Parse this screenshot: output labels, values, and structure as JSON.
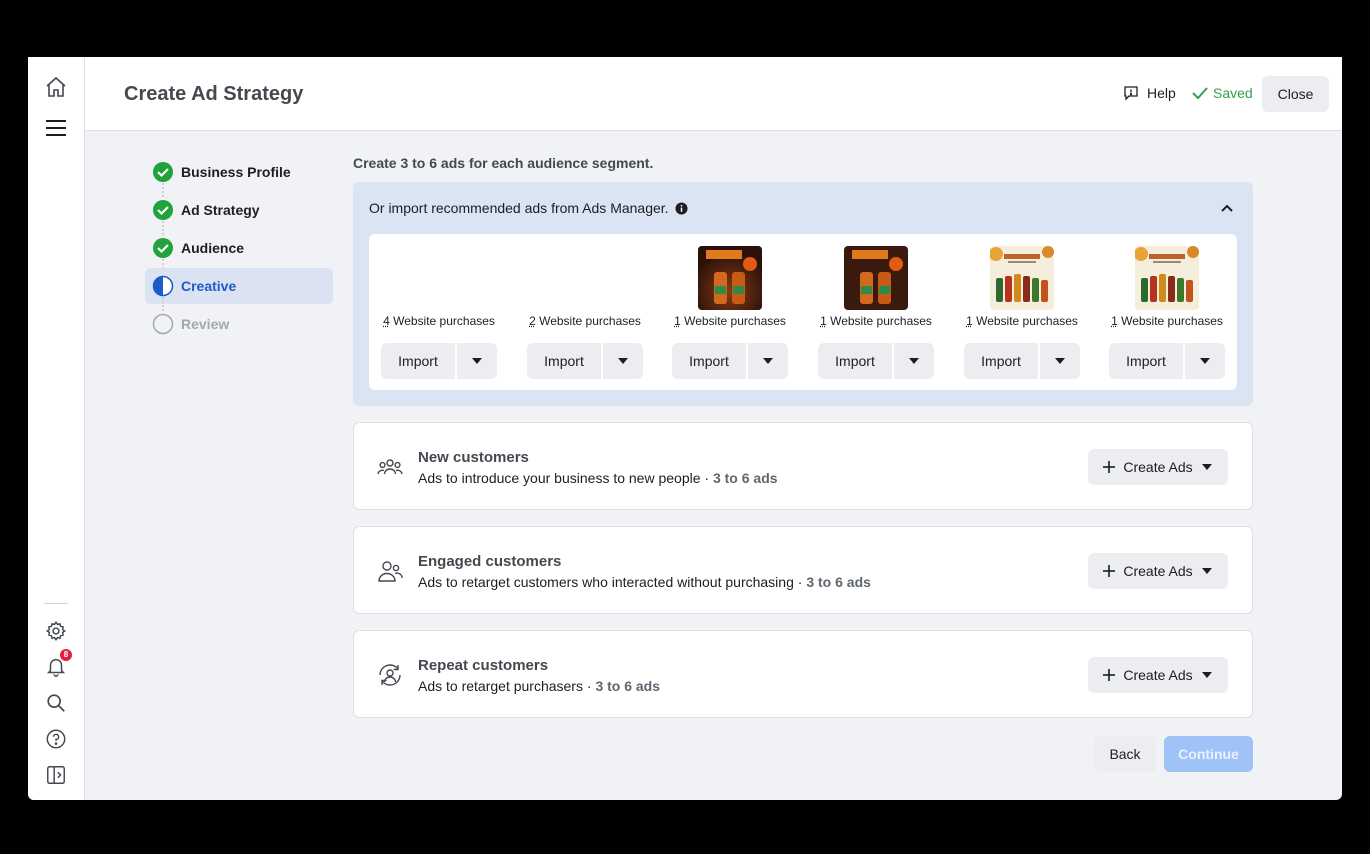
{
  "rail": {
    "notification_count": "8"
  },
  "header": {
    "title": "Create Ad Strategy",
    "help_label": "Help",
    "saved_label": "Saved",
    "close_label": "Close"
  },
  "steps": [
    {
      "label": "Business Profile",
      "state": "complete"
    },
    {
      "label": "Ad Strategy",
      "state": "complete"
    },
    {
      "label": "Audience",
      "state": "complete"
    },
    {
      "label": "Creative",
      "state": "in-progress"
    },
    {
      "label": "Review",
      "state": "pending"
    }
  ],
  "intro": "Create 3 to 6 ads for each audience segment.",
  "import_panel": {
    "heading": "Or import recommended ads from Ads Manager.",
    "ads": [
      {
        "count": "4",
        "label": "Website purchases",
        "thumbnail": "none",
        "import_label": "Import"
      },
      {
        "count": "2",
        "label": "Website purchases",
        "thumbnail": "none",
        "import_label": "Import"
      },
      {
        "count": "1",
        "label": "Website purchases",
        "thumbnail": "bundle-deal",
        "import_label": "Import"
      },
      {
        "count": "1",
        "label": "Website purchases",
        "thumbnail": "bundle-deal",
        "import_label": "Import"
      },
      {
        "count": "1",
        "label": "Website purchases",
        "thumbnail": "thanksgiving",
        "import_label": "Import"
      },
      {
        "count": "1",
        "label": "Website purchases",
        "thumbnail": "thanksgiving",
        "import_label": "Import"
      }
    ]
  },
  "segments": [
    {
      "title": "New customers",
      "description": "Ads to introduce your business to new people",
      "range": "3 to 6 ads",
      "button": "Create Ads",
      "icon": "group-icon"
    },
    {
      "title": "Engaged customers",
      "description": "Ads to retarget customers who interacted without purchasing",
      "range": "3 to 6 ads",
      "button": "Create Ads",
      "icon": "people-icon"
    },
    {
      "title": "Repeat customers",
      "description": "Ads to retarget purchasers",
      "range": "3 to 6 ads",
      "button": "Create Ads",
      "icon": "user-cycle-icon"
    }
  ],
  "footer": {
    "back_label": "Back",
    "continue_label": "Continue"
  },
  "colors": {
    "accent": "#1d5bc9",
    "success": "#31a24c",
    "panel": "#dbe4f3"
  }
}
